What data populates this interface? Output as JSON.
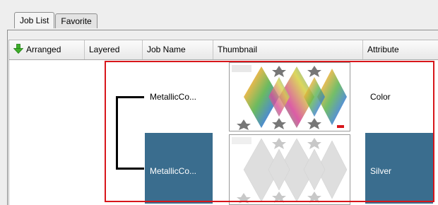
{
  "tabs": [
    {
      "label": "Job List",
      "active": true
    },
    {
      "label": "Favorite",
      "active": false
    }
  ],
  "columns": [
    "Arranged",
    "Layered",
    "Job Name",
    "Thumbnail",
    "Attribute"
  ],
  "rows": [
    {
      "job_name": "MetallicCo...",
      "attribute": "Color",
      "selected": false,
      "thumbnail": "color-print-layout"
    },
    {
      "job_name": "MetallicCo...",
      "attribute": "Silver",
      "selected": true,
      "thumbnail": "silver-print-layout"
    }
  ],
  "colors": {
    "selection": "#3a6d8e",
    "highlight_frame": "#d8161b",
    "arrow": "#3fae2a"
  },
  "icons": {
    "arranged_header": "down-arrow-icon"
  }
}
